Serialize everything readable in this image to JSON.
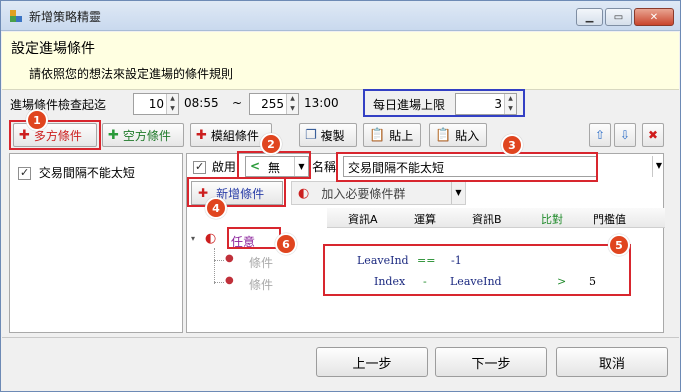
{
  "window": {
    "title": "新增策略精靈"
  },
  "banner": {
    "title": "設定進場條件",
    "subtitle": "請依照您的想法來設定進場的條件規則"
  },
  "time_range": {
    "label": "進場條件檢查起迄",
    "start_value": "10",
    "start_time": "08:55",
    "separator": "~",
    "end_value": "255",
    "end_time": "13:00"
  },
  "daily_limit": {
    "label": "每日進場上限",
    "value": "3"
  },
  "toolbar": {
    "long_label": "多方條件",
    "short_label": "空方條件",
    "module_label": "模組條件",
    "copy_label": "複製",
    "paste_label": "貼上",
    "paste_in_label": "貼入"
  },
  "strategy_list": [
    {
      "label": "交易間隔不能太短",
      "checked": true
    }
  ],
  "condition_editor": {
    "enable_label": "啟用",
    "mode_value": "無",
    "name_label": "名稱",
    "name_value": "交易間隔不能太短",
    "add_condition_label": "新增條件",
    "add_group_label": "加入必要條件群"
  },
  "grid": {
    "columns": [
      "資訊A",
      "運算",
      "資訊B",
      "比對",
      "門檻值"
    ],
    "root": {
      "label": "任意"
    },
    "rows": [
      {
        "tree_label": "條件",
        "info_a": "LeaveInd",
        "op": "==",
        "info_b": "-1",
        "compare": "",
        "threshold": ""
      },
      {
        "tree_label": "條件",
        "info_a": "Index",
        "op": "-",
        "info_b": "LeaveInd",
        "compare": ">",
        "threshold": "5"
      }
    ]
  },
  "badges": [
    "1",
    "2",
    "3",
    "4",
    "5",
    "6"
  ],
  "footer": {
    "prev_label": "上一步",
    "next_label": "下一步",
    "cancel_label": "取消"
  },
  "colors": {
    "title_bg": "#c9d9ee",
    "banner_bg": "#ffffe1",
    "highlight_red": "#d8262e",
    "highlight_blue": "#3340c4",
    "badge": "#e0451f",
    "long_icon": "#cc1f1f",
    "short_icon": "#2a9a3a",
    "op_green": "#1f8a2a",
    "root_label": "#8a1f9a"
  }
}
